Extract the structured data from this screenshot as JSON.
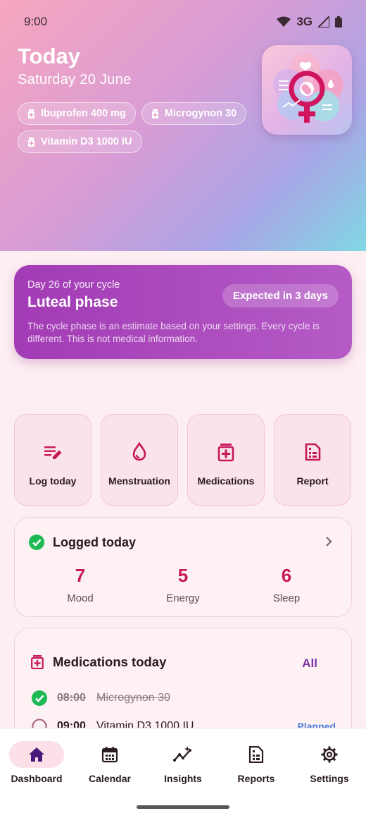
{
  "status_bar": {
    "time": "9:00",
    "network": "3G"
  },
  "header": {
    "title": "Today",
    "date": "Saturday 20 June",
    "chips": [
      "Ibuprofen 400 mg",
      "Microgynon 30",
      "Vitamin D3 1000 IU"
    ]
  },
  "cycle": {
    "day_text": "Day 26 of your cycle",
    "phase": "Luteal phase",
    "badge": "Expected in 3 days",
    "note": "The cycle phase is an estimate based on your settings. Every cycle is different. This is not medical information."
  },
  "quick_actions": [
    "Log today",
    "Menstruation",
    "Medications",
    "Report"
  ],
  "logged": {
    "title": "Logged today",
    "stats": [
      {
        "value": "7",
        "label": "Mood"
      },
      {
        "value": "5",
        "label": "Energy"
      },
      {
        "value": "6",
        "label": "Sleep"
      }
    ]
  },
  "medications": {
    "title": "Medications today",
    "all_label": "All",
    "rows": [
      {
        "time": "08:00",
        "name": "Microgynon 30",
        "status": ""
      },
      {
        "time": "09:00",
        "name": "Vitamin D3 1000 IU",
        "status": "Planned"
      }
    ]
  },
  "nav": {
    "items": [
      "Dashboard",
      "Calendar",
      "Insights",
      "Reports",
      "Settings"
    ],
    "active": "Dashboard"
  },
  "colors": {
    "accent": "#c7185a",
    "phase_card": "#a23bb5",
    "primary": "#7b2fa8"
  }
}
